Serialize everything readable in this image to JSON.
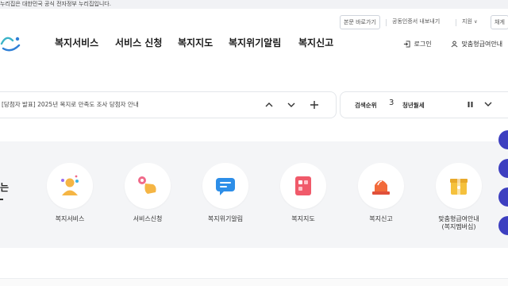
{
  "gov_banner": "누리집은 대한민국 공식 전자정부 누리집입니다.",
  "util": {
    "skip_link": "본문 바로가기",
    "cert_login": "공동인증서 내보내기",
    "support": "지원",
    "lang": "채게"
  },
  "gnb": {
    "items": [
      "복지서비스",
      "서비스 신청",
      "복지지도",
      "복지위기알림",
      "복지신고"
    ]
  },
  "header": {
    "login": "로그인",
    "guide": "맞춤형급여안내"
  },
  "notice": {
    "text": "[당첨자 발표] 2025년 복지로 만족도 조사 당첨자 안내"
  },
  "search_rank": {
    "label": "검색순위",
    "rank": "3",
    "term": "청년월세"
  },
  "services": {
    "side_title": "는",
    "items": [
      {
        "label": "복지서비스",
        "icon": "people-icon"
      },
      {
        "label": "서비스신청",
        "icon": "hand-touch-icon"
      },
      {
        "label": "복지위기알림",
        "icon": "message-icon"
      },
      {
        "label": "복지지도",
        "icon": "map-icon"
      },
      {
        "label": "복지신고",
        "icon": "siren-icon"
      },
      {
        "label": "맞춤형급여안내",
        "label2": "(복지멤버십)",
        "icon": "gift-box-icon"
      }
    ]
  },
  "colors": {
    "brand_blue": "#3d3fc0",
    "panel_bg": "#f4f5f7"
  }
}
